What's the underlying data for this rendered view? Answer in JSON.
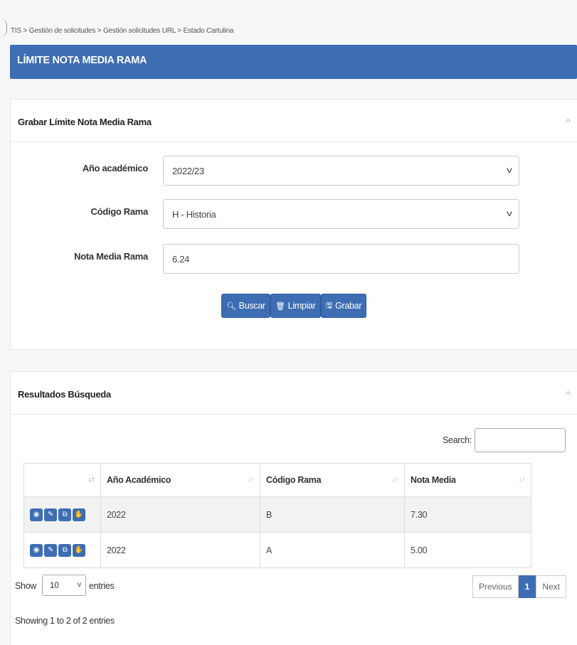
{
  "breadcrumb": "TIS > Gestión de solicitudes > Gestión solicitudes URL > Estado Cartulina",
  "page_title": "LÍMITE NOTA MEDIA RAMA",
  "form_panel": {
    "title": "Grabar Límite Nota Media Rama",
    "fields": {
      "year": {
        "label": "Año académico",
        "value": "2022/23"
      },
      "branch": {
        "label": "Código Rama",
        "value": "H - Historia"
      },
      "grade": {
        "label": "Nota Media Rama",
        "value": "6.24"
      }
    },
    "buttons": {
      "search": "Buscar",
      "clear": "Limpiar",
      "save": "Grabar"
    }
  },
  "results_panel": {
    "title": "Resultados Búsqueda",
    "search_label": "Search:",
    "search_value": "",
    "columns": [
      "Año Académico",
      "Código Rama",
      "Nota Media"
    ],
    "rows": [
      {
        "year": "2022",
        "branch": "B",
        "grade": "7.30"
      },
      {
        "year": "2022",
        "branch": "A",
        "grade": "5.00"
      }
    ],
    "length": {
      "show": "Show",
      "value": "10",
      "entries": "entries"
    },
    "info": "Showing 1 to 2 of 2 entries",
    "pager": {
      "previous": "Previous",
      "current": "1",
      "next": "Next"
    }
  },
  "colors": {
    "primary": "#3d6db3"
  }
}
